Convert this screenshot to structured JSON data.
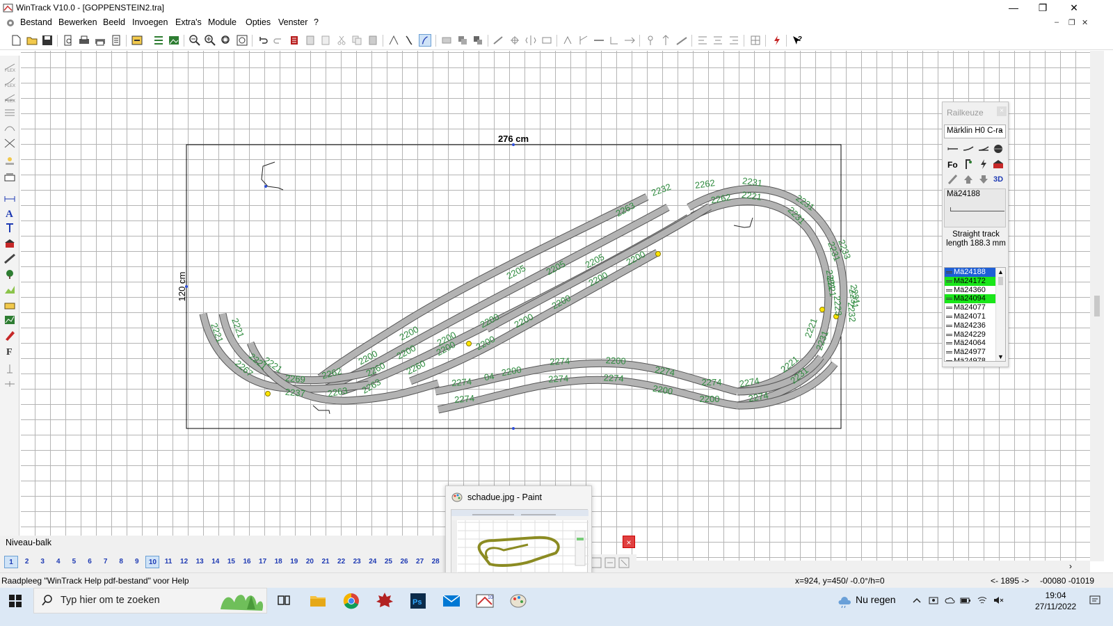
{
  "window": {
    "title": "WinTrack  V10.0 - [GOPPENSTEIN2.tra]",
    "controls": {
      "minimize": "—",
      "maximize": "❐",
      "close": "✕"
    }
  },
  "menu": {
    "items": [
      "Bestand",
      "Bewerken",
      "Beeld",
      "Invoegen",
      "Extra's",
      "Module",
      "Opties",
      "Venster",
      "?"
    ],
    "mdi": {
      "minimize": "–",
      "restore": "❐",
      "close": "✕"
    }
  },
  "board": {
    "width_label": "276 cm",
    "height_label": "120 cm",
    "track_color": "#b3b3b3",
    "label_color": "#2e8b3e",
    "track_labels": [
      {
        "text": "2262"
      },
      {
        "text": "2231"
      },
      {
        "text": "2232"
      },
      {
        "text": "2262"
      },
      {
        "text": "2221"
      },
      {
        "text": "2231"
      },
      {
        "text": "2263"
      },
      {
        "text": "2231"
      },
      {
        "text": "2231"
      },
      {
        "text": "2231"
      },
      {
        "text": "2205"
      },
      {
        "text": "2205"
      },
      {
        "text": "2205"
      },
      {
        "text": "2200"
      },
      {
        "text": "2200"
      },
      {
        "text": "2200"
      },
      {
        "text": "2200"
      },
      {
        "text": "2200"
      },
      {
        "text": "2200"
      },
      {
        "text": "2200"
      },
      {
        "text": "2200"
      },
      {
        "text": "2200"
      },
      {
        "text": "2200"
      },
      {
        "text": "2200"
      },
      {
        "text": "2260"
      },
      {
        "text": "2260"
      },
      {
        "text": "2262"
      },
      {
        "text": "2269"
      },
      {
        "text": "2263"
      },
      {
        "text": "2267"
      },
      {
        "text": "2221"
      },
      {
        "text": "2221"
      },
      {
        "text": "2221"
      },
      {
        "text": "2237"
      },
      {
        "text": "2263"
      },
      {
        "text": "2274"
      },
      {
        "text": "2274"
      },
      {
        "text": "04"
      },
      {
        "text": "2200"
      },
      {
        "text": "2274"
      },
      {
        "text": "2274"
      },
      {
        "text": "2200"
      },
      {
        "text": "2274"
      },
      {
        "text": "2274"
      },
      {
        "text": "2200"
      },
      {
        "text": "2274"
      },
      {
        "text": "2200"
      },
      {
        "text": "2274"
      },
      {
        "text": "2274"
      },
      {
        "text": "2221"
      },
      {
        "text": "2231"
      },
      {
        "text": "2221"
      },
      {
        "text": "2231"
      },
      {
        "text": "2221"
      },
      {
        "text": "2231"
      },
      {
        "text": "2233"
      },
      {
        "text": "2231"
      },
      {
        "text": "2223"
      },
      {
        "text": "2232"
      },
      {
        "text": "2221"
      }
    ]
  },
  "railkeuze": {
    "title": "Railkeuze",
    "close": "×",
    "system": "Märklin H0 C-ra",
    "selected_code": "Mä24188",
    "description_line1": "Straight track",
    "description_line2": "length 188.3 mm",
    "icon_3d": "3D",
    "list": [
      {
        "label": "Mä24188",
        "state": "selected"
      },
      {
        "label": "Mä24172",
        "state": "green"
      },
      {
        "label": "Mä24360",
        "state": "normal"
      },
      {
        "label": "Mä24094",
        "state": "green"
      },
      {
        "label": "Mä24077",
        "state": "normal"
      },
      {
        "label": "Mä24071",
        "state": "normal"
      },
      {
        "label": "Mä24236",
        "state": "normal"
      },
      {
        "label": "Mä24229",
        "state": "normal"
      },
      {
        "label": "Mä24064",
        "state": "normal"
      },
      {
        "label": "Mä24977",
        "state": "normal"
      },
      {
        "label": "Mä24978",
        "state": "normal"
      }
    ]
  },
  "niveau": {
    "title": "Niveau-balk",
    "active_level": "10",
    "levels": [
      "1",
      "2",
      "3",
      "4",
      "5",
      "6",
      "7",
      "8",
      "9",
      "10",
      "11",
      "12",
      "13",
      "14",
      "15",
      "16",
      "17",
      "18",
      "19",
      "20",
      "21",
      "22",
      "23",
      "24",
      "25",
      "26",
      "27",
      "28"
    ]
  },
  "paint": {
    "title": "schadue.jpg - Paint"
  },
  "status": {
    "help": "Raadpleeg \"WinTrack Help pdf-bestand\" voor Help",
    "coords": "x=924, y=450/ -0.0°/h=0",
    "range": "<- 1895 ->",
    "offset": "-00080 -01019"
  },
  "taskbar": {
    "search_placeholder": "Typ hier om te zoeken",
    "weather": "Nu regen",
    "time": "19:04",
    "date": "27/11/2022"
  }
}
